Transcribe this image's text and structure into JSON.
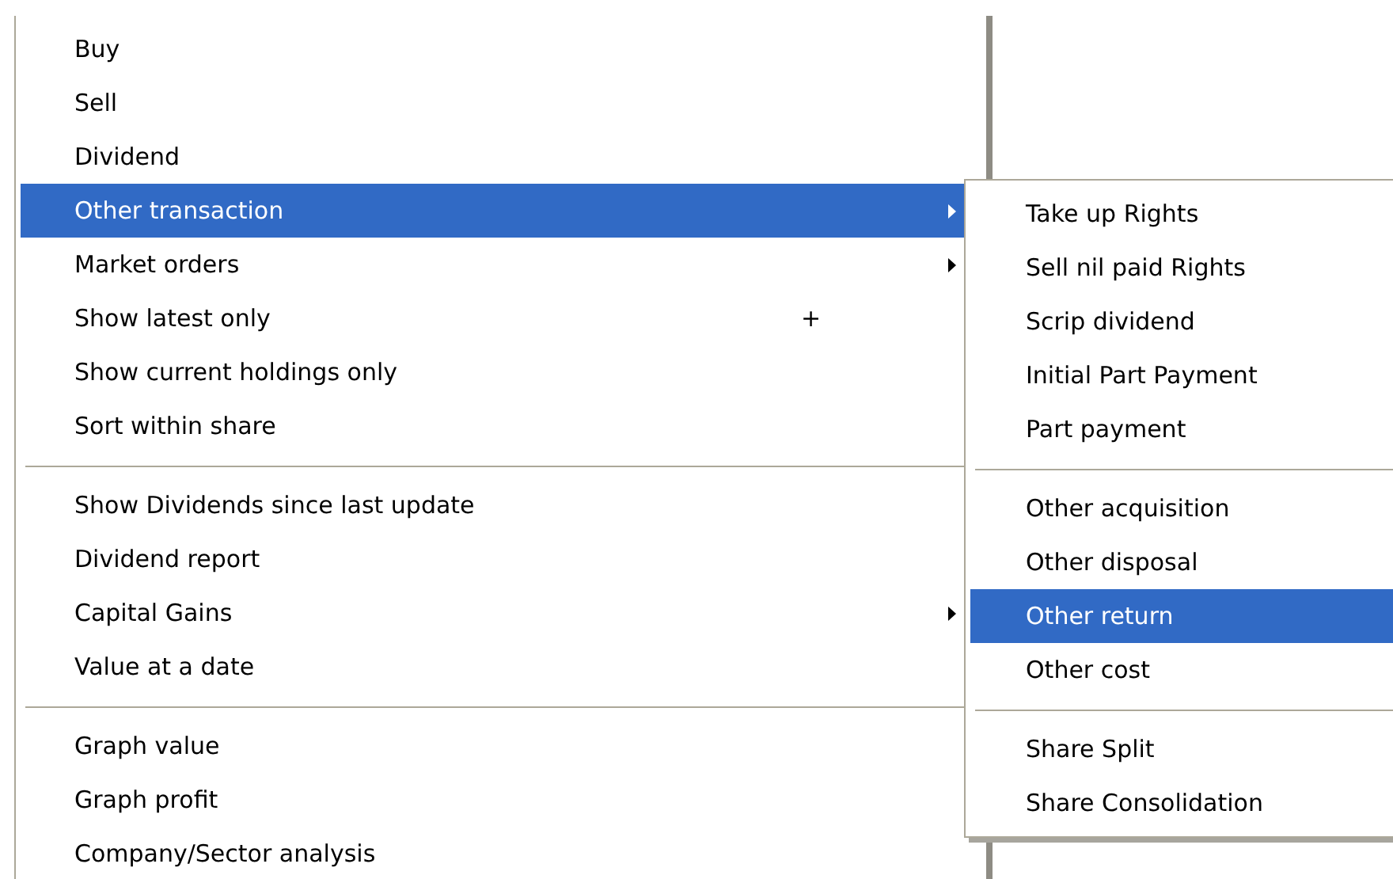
{
  "menu": {
    "items": [
      {
        "kind": "item",
        "label": "Buy",
        "selected": false
      },
      {
        "kind": "item",
        "label": "Sell",
        "selected": false
      },
      {
        "kind": "item",
        "label": "Dividend",
        "selected": false
      },
      {
        "kind": "item",
        "label": "Other transaction",
        "selected": true,
        "submenu": true
      },
      {
        "kind": "item",
        "label": "Market orders",
        "selected": false,
        "submenu": true
      },
      {
        "kind": "item",
        "label": "Show latest only",
        "selected": false,
        "shortcut": "+"
      },
      {
        "kind": "item",
        "label": "Show current holdings only",
        "selected": false
      },
      {
        "kind": "item",
        "label": "Sort within share",
        "selected": false
      },
      {
        "kind": "separator"
      },
      {
        "kind": "item",
        "label": "Show Dividends since last update",
        "selected": false
      },
      {
        "kind": "item",
        "label": "Dividend report",
        "selected": false
      },
      {
        "kind": "item",
        "label": "Capital Gains",
        "selected": false,
        "submenu": true
      },
      {
        "kind": "item",
        "label": "Value at a date",
        "selected": false
      },
      {
        "kind": "separator"
      },
      {
        "kind": "item",
        "label": "Graph value",
        "selected": false
      },
      {
        "kind": "item",
        "label": "Graph profit",
        "selected": false
      },
      {
        "kind": "item",
        "label": "Company/Sector analysis",
        "selected": false
      }
    ]
  },
  "submenu": {
    "items": [
      {
        "kind": "item",
        "label": "Take up Rights",
        "selected": false
      },
      {
        "kind": "item",
        "label": "Sell nil paid Rights",
        "selected": false
      },
      {
        "kind": "item",
        "label": "Scrip dividend",
        "selected": false
      },
      {
        "kind": "item",
        "label": "Initial Part Payment",
        "selected": false
      },
      {
        "kind": "item",
        "label": "Part payment",
        "selected": false
      },
      {
        "kind": "separator"
      },
      {
        "kind": "item",
        "label": "Other acquisition",
        "selected": false
      },
      {
        "kind": "item",
        "label": "Other disposal",
        "selected": false
      },
      {
        "kind": "item",
        "label": "Other return",
        "selected": true
      },
      {
        "kind": "item",
        "label": "Other cost",
        "selected": false
      },
      {
        "kind": "separator"
      },
      {
        "kind": "item",
        "label": "Share Split",
        "selected": false
      },
      {
        "kind": "item",
        "label": "Share Consolidation",
        "selected": false
      }
    ]
  }
}
